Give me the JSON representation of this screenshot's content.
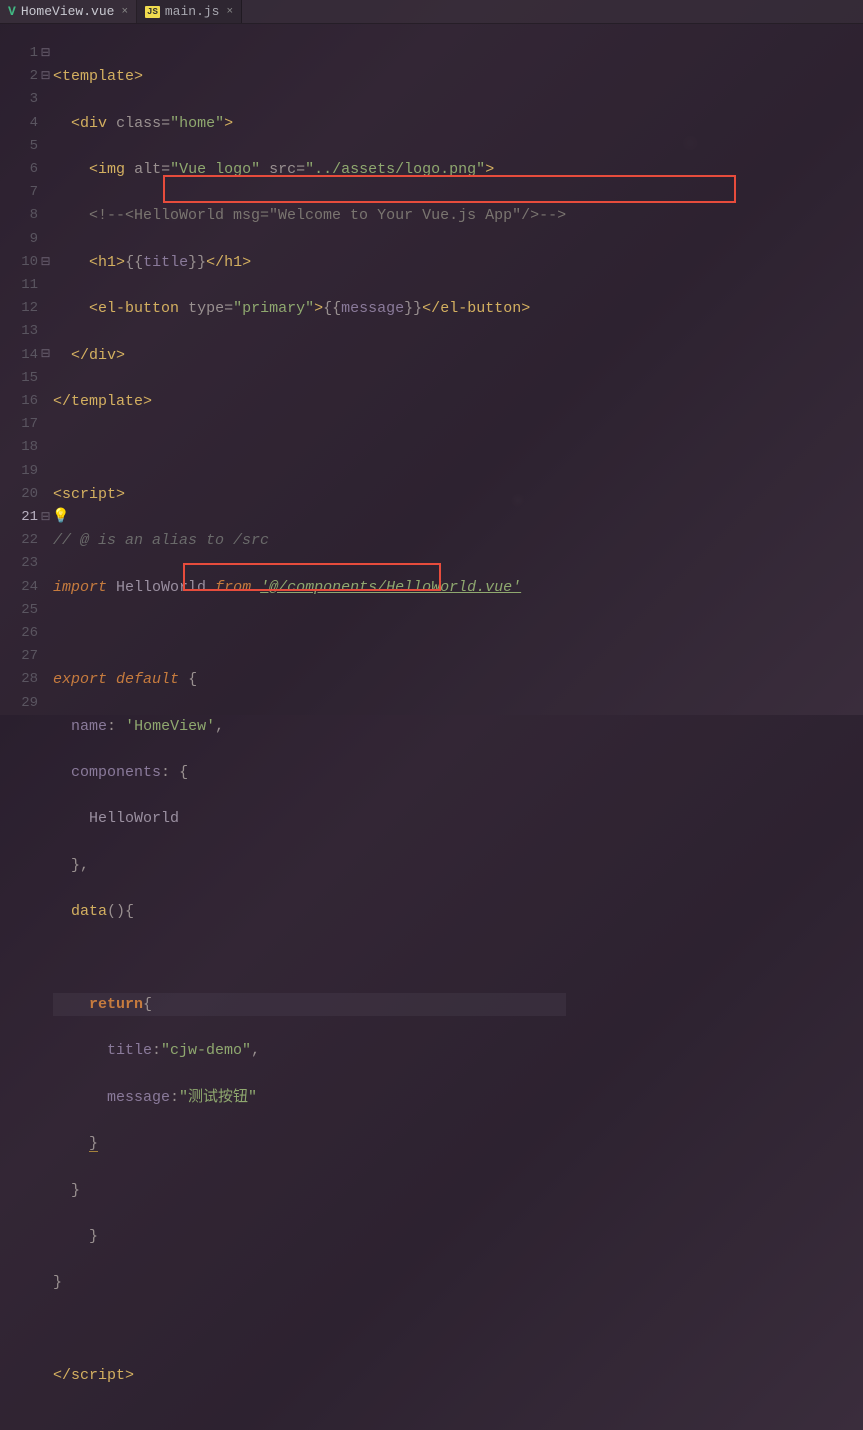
{
  "tabs": [
    {
      "name": "HomeView.vue",
      "icon": "V",
      "active": true
    },
    {
      "name": "main.js",
      "icon": "JS",
      "active": false
    }
  ],
  "gutter": [
    "1",
    "2",
    "3",
    "4",
    "5",
    "6",
    "7",
    "8",
    "9",
    "10",
    "11",
    "12",
    "13",
    "14",
    "15",
    "16",
    "17",
    "18",
    "19",
    "20",
    "21",
    "22",
    "23",
    "24",
    "25",
    "26",
    "27",
    "28",
    "29"
  ],
  "current_line": 21,
  "fold": {
    "l1": "⊟",
    "l2": "⊟",
    "l10": "⊟",
    "l14": "⊟",
    "l21": "⊟"
  },
  "code": {
    "l1": {
      "tag_open": "<",
      "tag": "template",
      "tag_close": ">"
    },
    "l2": {
      "tag_open": "<",
      "tag": "div",
      "attr": "class",
      "eq": "=",
      "val": "\"home\"",
      "tag_close": ">"
    },
    "l3": {
      "tag_open": "<",
      "tag": "img",
      "attr1": "alt",
      "val1": "\"Vue logo\"",
      "attr2": "src",
      "val2": "\"../assets/logo.png\"",
      "tag_close": ">"
    },
    "l4": {
      "comment": "<!--<HelloWorld msg=\"Welcome to Your Vue.js App\"/>-->"
    },
    "l5": {
      "tag_open": "<",
      "tag": "h1",
      "tag_close": ">",
      "m_open": "{{",
      "var": "title",
      "m_close": "}}",
      "ctag_open": "</",
      "ctag": "h1",
      "ctag_close": ">"
    },
    "l6": {
      "tag_open": "<",
      "tag": "el-button",
      "attr": "type",
      "val": "\"primary\"",
      "tag_close": ">",
      "m_open": "{{",
      "var": "message",
      "m_close": "}}",
      "ctag_open": "</",
      "ctag": "el-button",
      "ctag_close": ">"
    },
    "l7": {
      "ctag_open": "</",
      "ctag": "div",
      "ctag_close": ">"
    },
    "l8": {
      "ctag_open": "</",
      "ctag": "template",
      "ctag_close": ">"
    },
    "l10": {
      "tag_open": "<",
      "tag": "script",
      "tag_close": ">"
    },
    "l11": {
      "comment": "// @ is an alias to /src"
    },
    "l12": {
      "kw1": "import",
      "ident": "HelloWorld",
      "kw2": "from",
      "path": "'@/components/HelloWorld.vue'"
    },
    "l14": {
      "kw1": "export",
      "kw2": "default",
      "brace": "{"
    },
    "l15": {
      "prop": "name",
      "colon": ":",
      "val": "'HomeView'",
      "comma": ","
    },
    "l16": {
      "prop": "components",
      "colon": ":",
      "brace": "{"
    },
    "l17": {
      "ident": "HelloWorld"
    },
    "l18": {
      "brace": "}",
      "comma": ","
    },
    "l19": {
      "func": "data",
      "parens": "()",
      "brace": "{"
    },
    "l21": {
      "kw": "return",
      "brace": "{"
    },
    "l22": {
      "prop": "title",
      "colon": ":",
      "val": "\"cjw-demo\"",
      "comma": ","
    },
    "l23": {
      "prop": "message",
      "colon": ":",
      "val": "\"测试按钮\""
    },
    "l24": {
      "brace": "}"
    },
    "l25": {
      "brace": "}"
    },
    "l26": {
      "brace": "}"
    },
    "l27": {
      "brace": "}"
    },
    "l29": {
      "ctag_open": "</",
      "ctag": "script",
      "ctag_close": ">"
    }
  }
}
